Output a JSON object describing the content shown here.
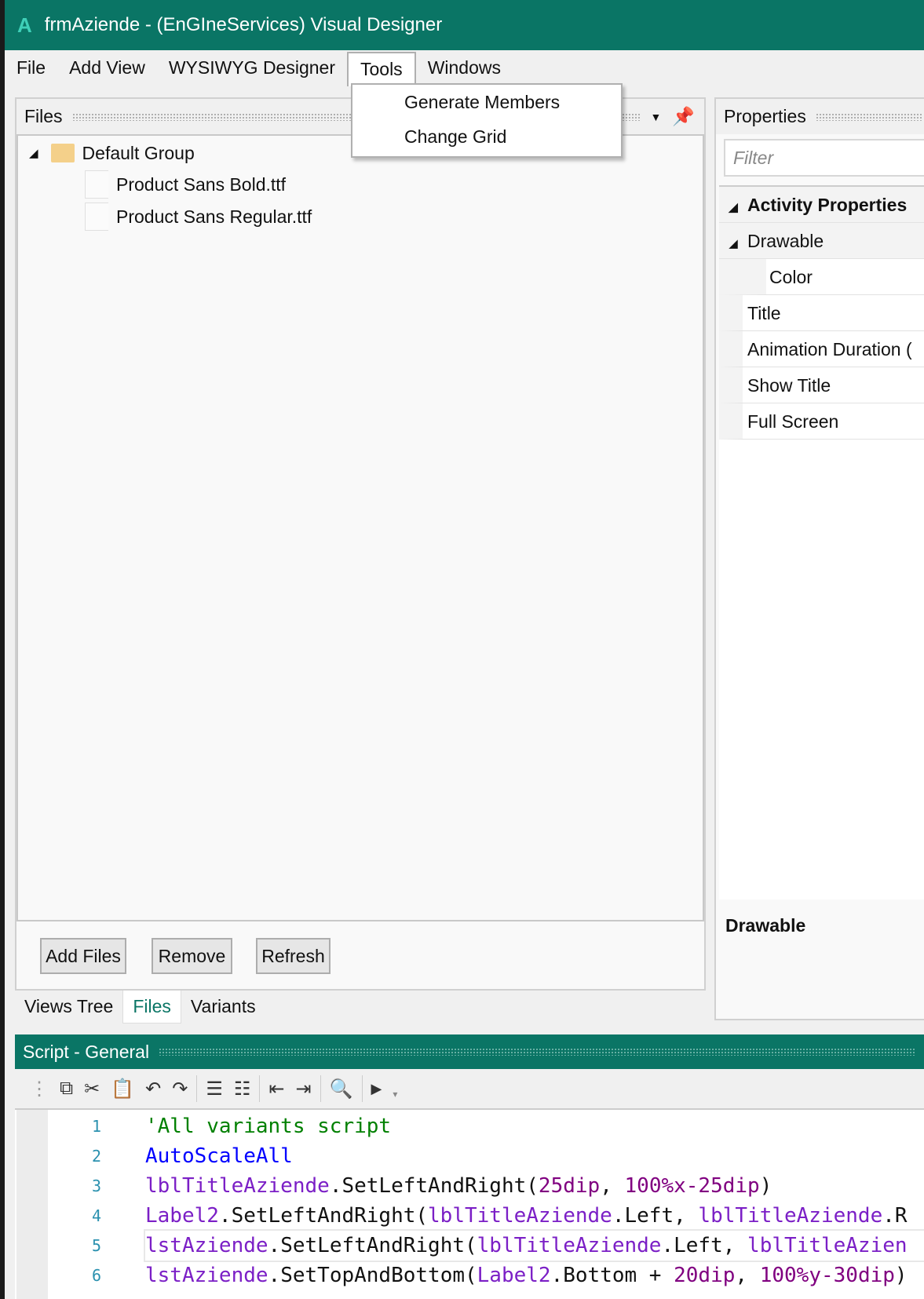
{
  "window": {
    "title": "frmAziende - (EnGIneServices) Visual Designer",
    "logo": "A"
  },
  "menu": [
    "File",
    "Add View",
    "WYSIWYG Designer",
    "Tools",
    "Windows"
  ],
  "tools_menu": [
    "Generate Members",
    "Change Grid"
  ],
  "files_panel": {
    "title": "Files",
    "group": "Default Group",
    "files": [
      "Product Sans Bold.ttf",
      "Product Sans Regular.ttf"
    ],
    "buttons": {
      "add": "Add Files",
      "remove": "Remove",
      "refresh": "Refresh"
    }
  },
  "tabs": [
    "Views Tree",
    "Files",
    "Variants"
  ],
  "active_tab": "Files",
  "properties": {
    "title": "Properties",
    "filter_placeholder": "Filter",
    "rows": [
      "Activity Properties",
      "Drawable",
      "Color",
      "Title",
      "Animation Duration (",
      "Show Title",
      "Full Screen"
    ],
    "description": "Drawable"
  },
  "script": {
    "title": "Script - General",
    "lines": [
      {
        "n": "1",
        "tokens": [
          [
            "cm",
            "'All variants script"
          ]
        ]
      },
      {
        "n": "2",
        "tokens": [
          [
            "kw",
            "AutoScaleAll"
          ]
        ]
      },
      {
        "n": "3",
        "tokens": [
          [
            "id",
            "lblTitleAziende"
          ],
          [
            "pl",
            ".SetLeftAndRight("
          ],
          [
            "nm",
            "25dip"
          ],
          [
            "pl",
            ", "
          ],
          [
            "nm",
            "100%x-25dip"
          ],
          [
            "pl",
            ")"
          ]
        ]
      },
      {
        "n": "4",
        "tokens": [
          [
            "id",
            "Label2"
          ],
          [
            "pl",
            ".SetLeftAndRight("
          ],
          [
            "id",
            "lblTitleAziende"
          ],
          [
            "pl",
            ".Left, "
          ],
          [
            "id",
            "lblTitleAziende"
          ],
          [
            "pl",
            ".R"
          ]
        ]
      },
      {
        "n": "5",
        "tokens": [
          [
            "id",
            "lstAziende"
          ],
          [
            "pl",
            ".SetLeftAndRight("
          ],
          [
            "id",
            "lblTitleAziende"
          ],
          [
            "pl",
            ".Left, "
          ],
          [
            "id",
            "lblTitleAzien"
          ]
        ]
      },
      {
        "n": "6",
        "tokens": [
          [
            "id",
            "lstAziende"
          ],
          [
            "pl",
            ".SetTopAndBottom("
          ],
          [
            "id",
            "Label2"
          ],
          [
            "pl",
            ".Bottom + "
          ],
          [
            "nm",
            "20dip"
          ],
          [
            "pl",
            ", "
          ],
          [
            "nm",
            "100%y-30dip"
          ],
          [
            "pl",
            ")"
          ]
        ]
      }
    ]
  },
  "colors": {
    "accent": "#0a7565",
    "comment": "#008000",
    "keyword": "#0000ff",
    "identifier": "#7b1fc6",
    "number": "#800080"
  }
}
